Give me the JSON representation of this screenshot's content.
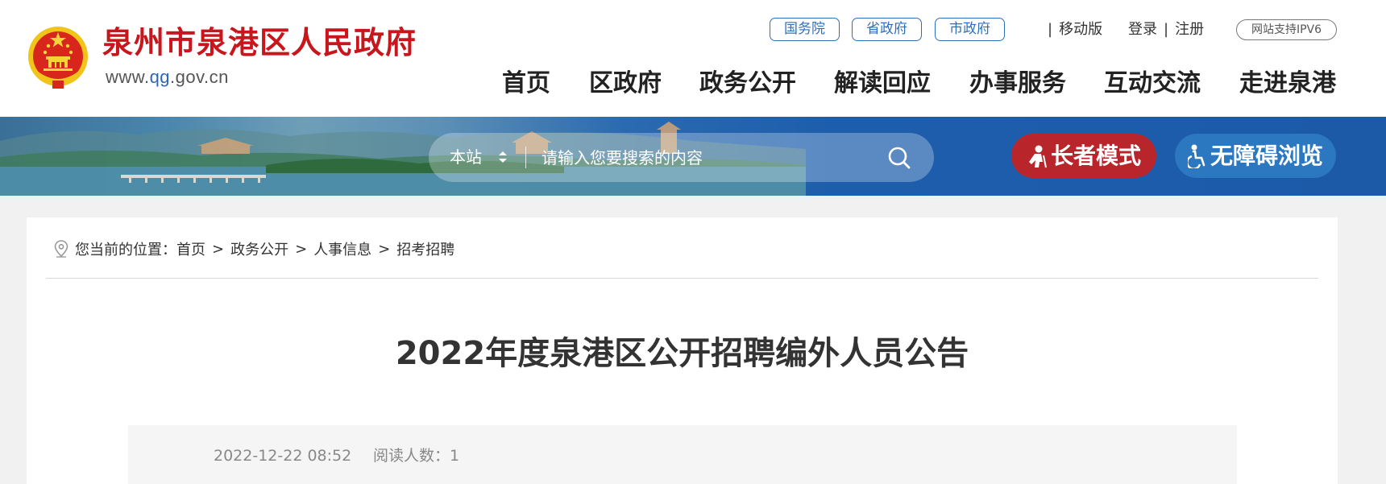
{
  "header": {
    "site_name": "泉州市泉港区人民政府",
    "site_url_prefix": "www.",
    "site_url_highlight": "qg",
    "site_url_suffix": ".gov.cn",
    "gov_links": [
      "国务院",
      "省政府",
      "市政府"
    ],
    "mobile_label": "移动版",
    "login_label": "登录",
    "register_label": "注册",
    "ipv6_label": "网站支持IPV6",
    "nav": [
      "首页",
      "区政府",
      "政务公开",
      "解读回应",
      "办事服务",
      "互动交流",
      "走进泉港"
    ]
  },
  "search": {
    "scope": "本站",
    "placeholder": "请输入您要搜索的内容"
  },
  "modes": {
    "elder": "长者模式",
    "accessible": "无障碍浏览"
  },
  "breadcrumb": {
    "prefix": "您当前的位置：",
    "items": [
      "首页",
      "政务公开",
      "人事信息",
      "招考招聘"
    ],
    "separator": ">"
  },
  "article": {
    "title": "2022年度泉港区公开招聘编外人员公告",
    "date": "2022-12-22 08:52",
    "views_label": "阅读人数：",
    "views": "1"
  },
  "colors": {
    "brand_red": "#c8161d",
    "link_blue": "#2e6fbd",
    "banner_blue": "#1c5aa8",
    "elder_red": "#b8262b",
    "access_blue": "#2b77c0"
  }
}
